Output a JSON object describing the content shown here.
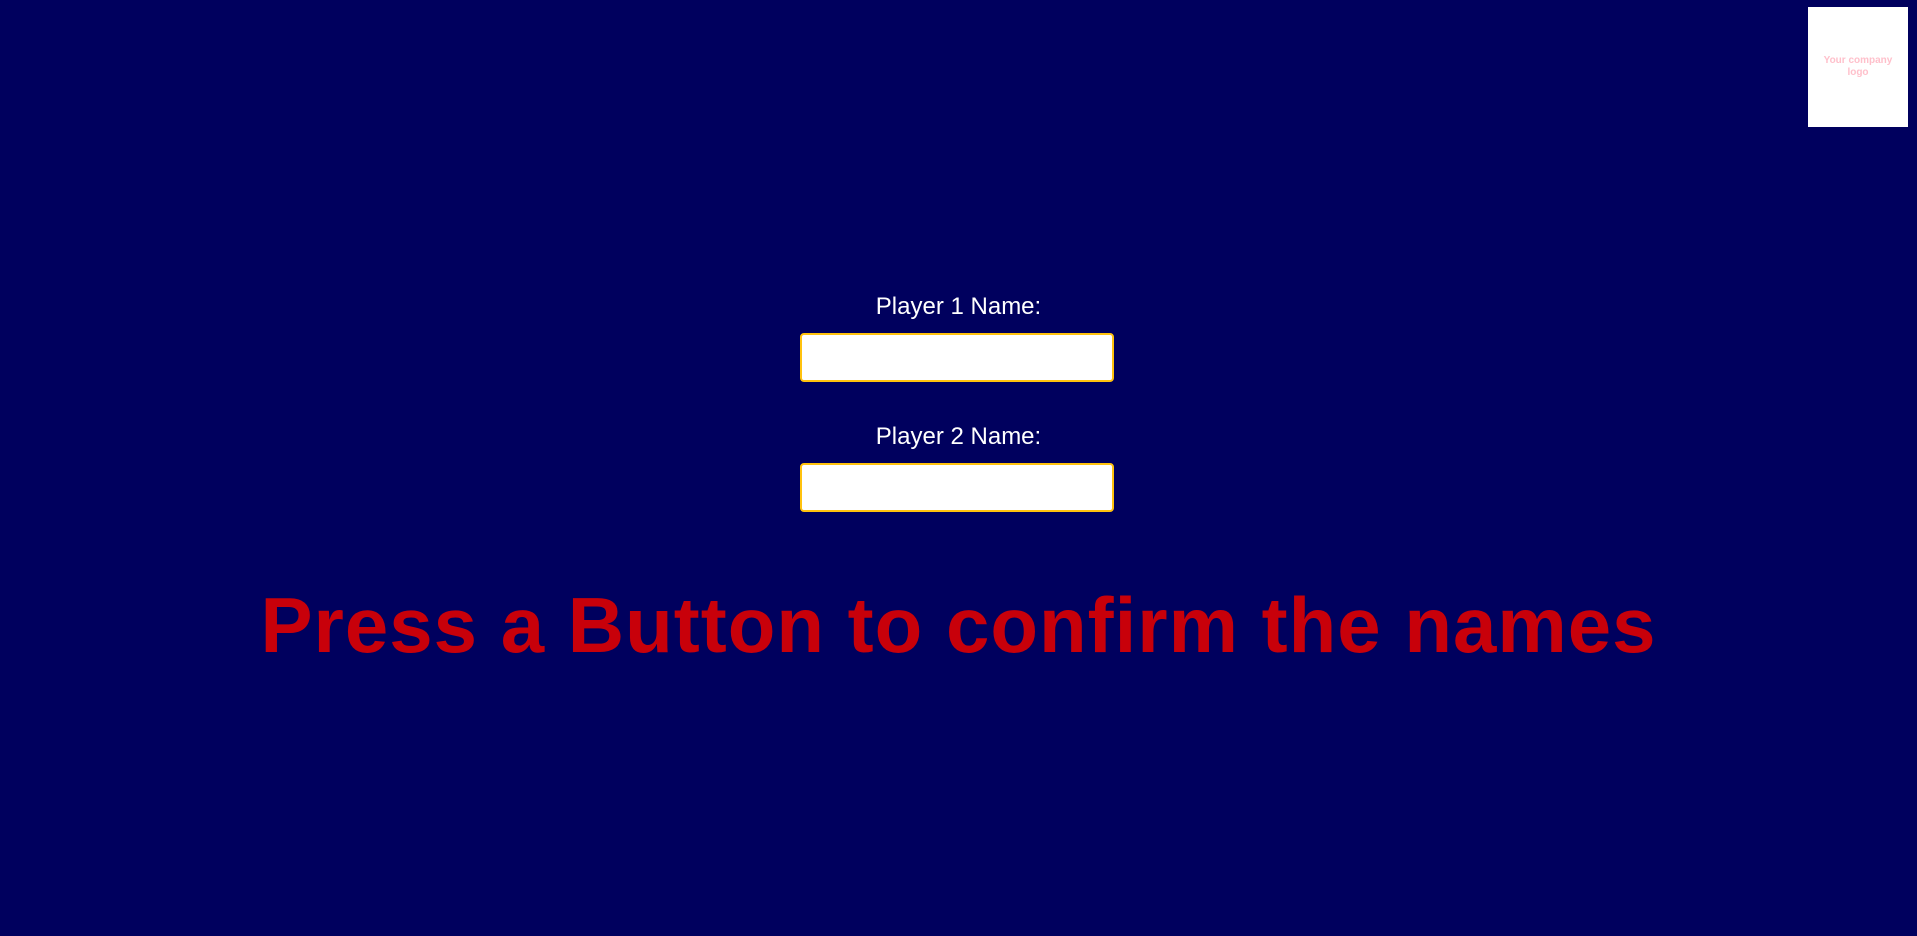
{
  "logo": {
    "text": "Your company logo"
  },
  "players": [
    {
      "label": "Player 1 Name:",
      "value": ""
    },
    {
      "label": "Player 2 Name:",
      "value": ""
    }
  ],
  "prompt": "Press a Button to confirm the names",
  "colors": {
    "background": "#00005e",
    "label": "#ffffff",
    "input_border": "#ffc20e",
    "prompt": "#c8000a",
    "logo_text": "#ffc0cb"
  }
}
